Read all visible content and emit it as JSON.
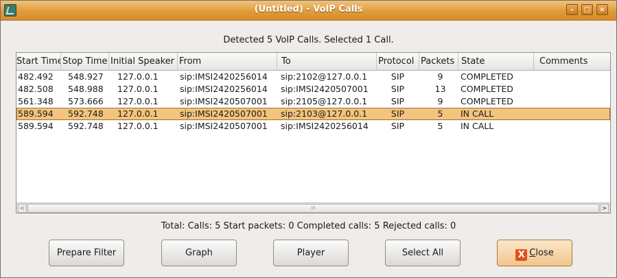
{
  "window": {
    "title": "(Untitled) - VoIP Calls",
    "controls": {
      "minimize": "–",
      "maximize": "□",
      "close": "×"
    }
  },
  "header_text": "Detected 5 VoIP Calls. Selected 1 Call.",
  "table": {
    "columns": [
      "Start Time",
      "Stop Time",
      "Initial Speaker",
      "From",
      "To",
      "Protocol",
      "Packets",
      "State",
      "Comments"
    ],
    "rows": [
      [
        "482.492",
        "548.927",
        "127.0.0.1",
        "sip:IMSI2420256014",
        "sip:2102@127.0.0.1",
        "SIP",
        "9",
        "COMPLETED",
        ""
      ],
      [
        "482.508",
        "548.988",
        "127.0.0.1",
        "sip:IMSI2420256014",
        "sip:IMSI2420507001",
        "SIP",
        "13",
        "COMPLETED",
        ""
      ],
      [
        "561.348",
        "573.666",
        "127.0.0.1",
        "sip:IMSI2420507001",
        "sip:2105@127.0.0.1",
        "SIP",
        "9",
        "COMPLETED",
        ""
      ],
      [
        "589.594",
        "592.748",
        "127.0.0.1",
        "sip:IMSI2420507001",
        "sip:2103@127.0.0.1",
        "SIP",
        "5",
        "IN CALL",
        ""
      ],
      [
        "589.594",
        "592.748",
        "127.0.0.1",
        "sip:IMSI2420507001",
        "sip:IMSI2420256014",
        "SIP",
        "5",
        "IN CALL",
        ""
      ]
    ],
    "selected_row": 3,
    "scroll": {
      "left_arrow": "<",
      "right_arrow": ">",
      "thumb_grip": "III"
    }
  },
  "summary_text": "Total: Calls: 5   Start packets: 0   Completed calls: 5   Rejected calls: 0",
  "buttons": {
    "prepare_filter": "Prepare Filter",
    "graph": "Graph",
    "player": "Player",
    "select_all": "Select All",
    "close_prefix": "",
    "close_underlined": "C",
    "close_rest": "lose",
    "close_icon": "X"
  },
  "colors": {
    "titlebar": "#e09c3c",
    "selection": "#f2c47e",
    "close_icon": "#e0531d"
  }
}
